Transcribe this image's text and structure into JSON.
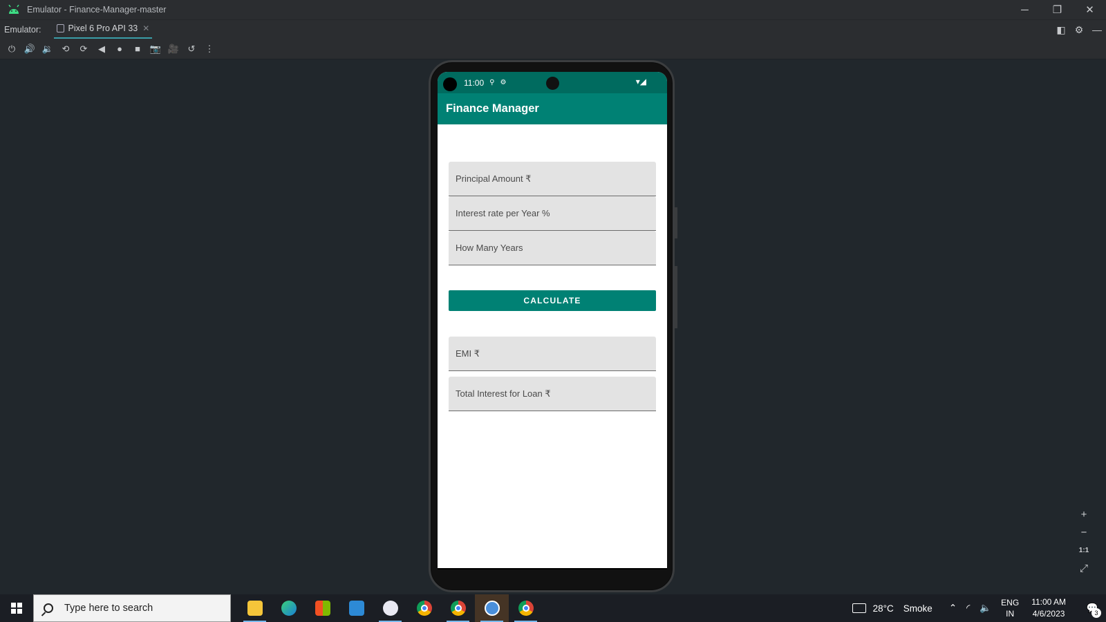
{
  "window": {
    "title": "Emulator - Finance-Manager-master"
  },
  "tabbar": {
    "label": "Emulator:",
    "tab": "Pixel 6 Pro API 33"
  },
  "phone": {
    "status": {
      "time": "11:00"
    },
    "app": {
      "title": "Finance Manager",
      "fields": {
        "principal_placeholder": "Principal Amount ₹",
        "interest_placeholder": "Interest rate per Year %",
        "years_placeholder": "How Many Years",
        "emi_placeholder": "EMI ₹",
        "total_interest_placeholder": "Total Interest for Loan ₹"
      },
      "calculate_label": "CALCULATE"
    }
  },
  "zoom": {
    "plus": "+",
    "minus": "−",
    "one_to_one": "1:1"
  },
  "taskbar": {
    "search_placeholder": "Type here to search",
    "weather": {
      "temp": "28°C",
      "condition": "Smoke"
    },
    "lang": {
      "line1": "ENG",
      "line2": "IN"
    },
    "clock": {
      "time": "11:00 AM",
      "date": "4/6/2023"
    },
    "notifications_count": "3"
  },
  "colors": {
    "primary": "#008174",
    "primary_dark": "#006b5f",
    "ide_bg": "#21272c"
  }
}
